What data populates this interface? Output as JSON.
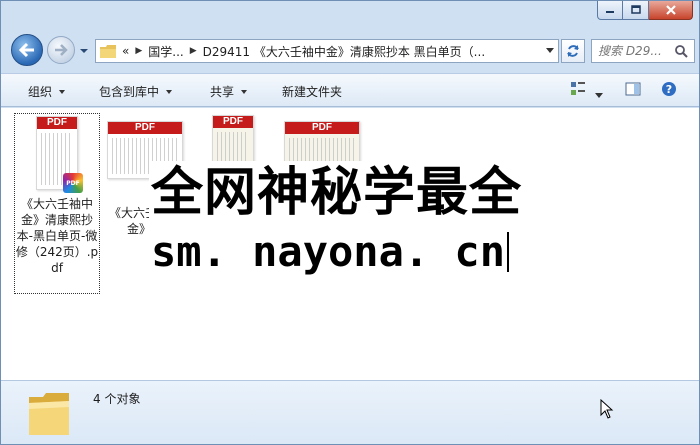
{
  "window": {
    "caption_buttons": [
      "minimize-icon",
      "maximize-icon",
      "close-icon"
    ]
  },
  "address": {
    "prefix": "«",
    "segments": [
      "国学...",
      "D29411 《大六壬袖中金》清康熙抄本 黑白单页（..."
    ]
  },
  "search": {
    "placeholder": "搜索 D29..."
  },
  "toolbar": {
    "organize": "组织",
    "include_in_library": "包含到库中",
    "share": "共享",
    "new_folder": "新建文件夹"
  },
  "files": [
    {
      "label": "《大六壬袖中金》清康熙抄本-黑白单页-微修（242页）.pdf",
      "selected": true
    },
    {
      "label": "《大六壬袖中金》清",
      "selected": false
    },
    {
      "label": "",
      "selected": false
    },
    {
      "label": "",
      "selected": false
    }
  ],
  "thumb_badge": "PDF",
  "watermark": {
    "line1": "全网神秘学最全",
    "line2": "sm. nayona. cn"
  },
  "status": {
    "count_text": "4 个对象"
  }
}
